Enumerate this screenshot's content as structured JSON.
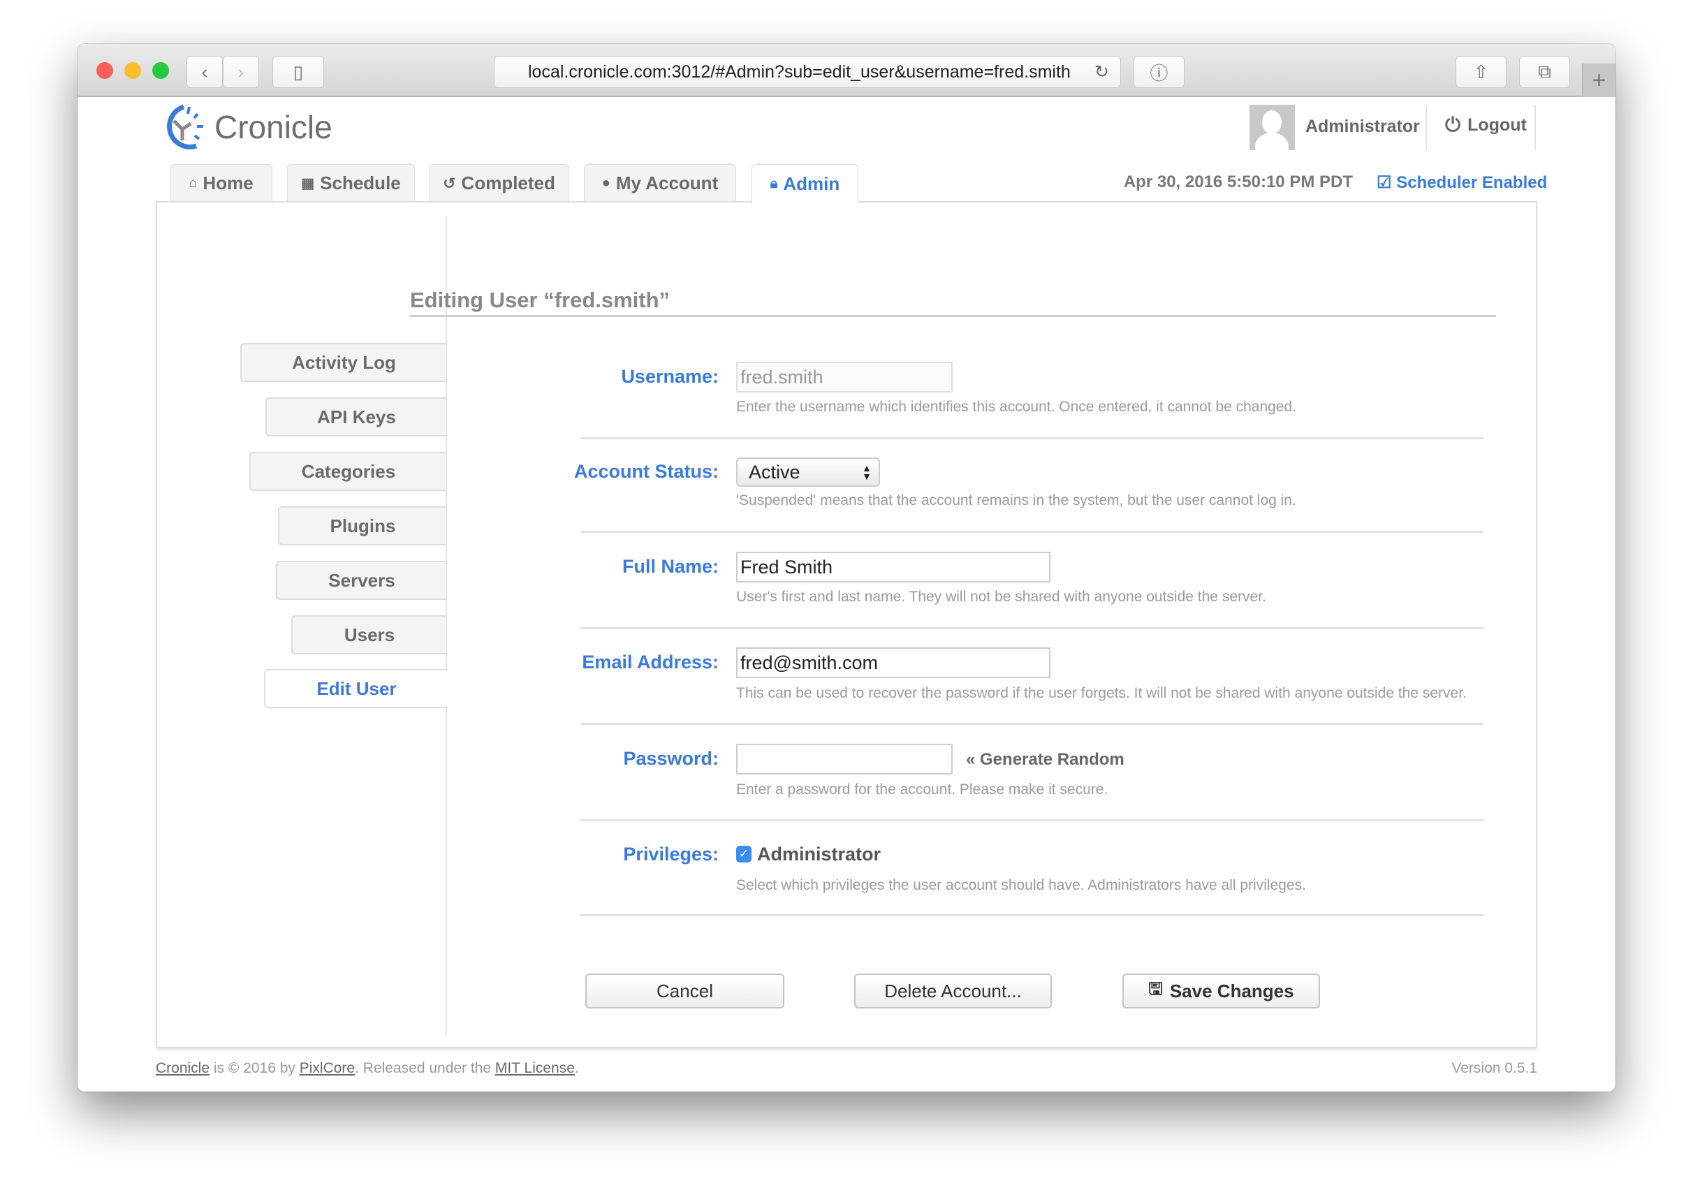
{
  "browser": {
    "url": "local.cronicle.com:3012/#Admin?sub=edit_user&username=fred.smith",
    "icons": [
      "back-icon",
      "forward-icon",
      "sidebar-icon",
      "reload-icon",
      "info-icon",
      "share-icon",
      "tabs-icon",
      "new-tab-icon"
    ]
  },
  "header": {
    "app_name": "Cronicle",
    "user": "Administrator",
    "logout": "Logout",
    "datetime": "Apr 30, 2016 5:50:10 PM PDT",
    "scheduler": "Scheduler Enabled",
    "accent": "#3a7ad9"
  },
  "tabs": [
    {
      "label": "Home",
      "icon": "home-icon"
    },
    {
      "label": "Schedule",
      "icon": "calendar-icon"
    },
    {
      "label": "Completed",
      "icon": "history-icon"
    },
    {
      "label": "My Account",
      "icon": "user-icon"
    },
    {
      "label": "Admin",
      "icon": "lock-icon",
      "active": true
    }
  ],
  "sidebar": {
    "items": [
      {
        "label": "Activity Log"
      },
      {
        "label": "API Keys"
      },
      {
        "label": "Categories"
      },
      {
        "label": "Plugins"
      },
      {
        "label": "Servers"
      },
      {
        "label": "Users"
      },
      {
        "label": "Edit User",
        "active": true
      }
    ]
  },
  "form": {
    "title": "Editing User “fred.smith”",
    "username": {
      "label": "Username:",
      "value": "fred.smith",
      "hint": "Enter the username which identifies this account. Once entered, it cannot be changed."
    },
    "status": {
      "label": "Account Status:",
      "value": "Active",
      "hint": "'Suspended' means that the account remains in the system, but the user cannot log in."
    },
    "fullname": {
      "label": "Full Name:",
      "value": "Fred Smith",
      "hint": "User's first and last name. They will not be shared with anyone outside the server."
    },
    "email": {
      "label": "Email Address:",
      "value": "fred@smith.com",
      "hint": "This can be used to recover the password if the user forgets. It will not be shared with anyone outside the server."
    },
    "password": {
      "label": "Password:",
      "value": "",
      "generate": "« Generate Random",
      "hint": "Enter a password for the account. Please make it secure."
    },
    "privileges": {
      "label": "Privileges:",
      "option": "Administrator",
      "checked": true,
      "hint": "Select which privileges the user account should have. Administrators have all privileges."
    }
  },
  "buttons": {
    "cancel": "Cancel",
    "delete": "Delete Account...",
    "save": "Save Changes"
  },
  "footer": {
    "app_link": "Cronicle",
    "text1": " is © 2016 by ",
    "company_link": "PixlCore",
    "text2": ". Released under the ",
    "license_link": "MIT License",
    "text3": ".",
    "version": "Version 0.5.1"
  }
}
